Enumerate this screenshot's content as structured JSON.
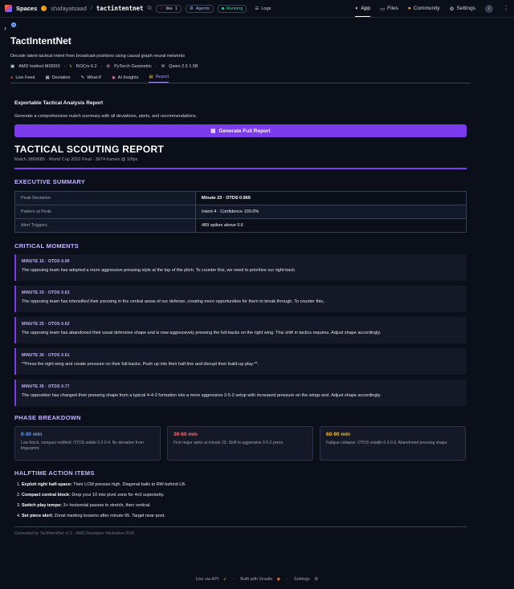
{
  "topbar": {
    "spaces_label": "Spaces",
    "owner": "shafayatsaad",
    "separator": "/",
    "repo": "tactintentnet",
    "like_label": "like",
    "like_count": "1",
    "agents_label": "Agents",
    "status_label": "Running",
    "logs_label": "Logs",
    "nav": {
      "app": "App",
      "files": "Files",
      "community": "Community",
      "settings": "Settings"
    },
    "info_badge": "i",
    "more": "⋮"
  },
  "app": {
    "title": "TactIntentNet",
    "description": "Decode latent tactical intent from broadcast positions using causal graph neural networks",
    "hardware": [
      "AMD Instinct MI300X",
      "ROCm 6.2",
      "PyTorch Geometric",
      "Qwen 2.5 1.5B"
    ],
    "hardware_sep": "·",
    "tabs": [
      {
        "label": "Live Feed",
        "icon": "●"
      },
      {
        "label": "Deviation",
        "icon": "▦"
      },
      {
        "label": "What-If",
        "icon": "✎"
      },
      {
        "label": "AI Insights",
        "icon": "◉"
      },
      {
        "label": "Report",
        "icon": "▤"
      }
    ],
    "active_tab": "Report"
  },
  "report_panel": {
    "heading": "Exportable Tactical Analysis Report",
    "subtext": "Generate a comprehensive match summary with all deviations, alerts, and recommendations.",
    "button_label": "Generate Full Report",
    "generated_by": "Generated by TactIntentNet v1.0 · AMD Developer Hackathon 2026"
  },
  "report": {
    "title": "TACTICAL SCOUTING REPORT",
    "meta": "Match 3869685 · World Cup 2022 Final · 3674 frames @ 10fps",
    "executive_summary": {
      "heading": "EXECUTIVE SUMMARY",
      "rows": [
        {
          "key": "Peak Deviation",
          "value": "Minute 23 · OTDS 0.969"
        },
        {
          "key": "Pattern at Peak",
          "value": "Intent 4 · Confidence 100.0%"
        },
        {
          "key": "Alert Triggers",
          "value": "489 spikes above 0.6"
        }
      ]
    },
    "critical_moments": {
      "heading": "CRITICAL MOMENTS",
      "items": [
        {
          "label": "MINUTE 15 · OTDS 0.90",
          "text": "The opposing team has adopted a more aggressive pressing style at the top of the pitch. To counter this, we need to prioritize our right-back."
        },
        {
          "label": "MINUTE 20 · OTDS 0.63",
          "text": "The opposing team has intensified their pressing in the central areas of our defense, creating more opportunities for them to break through. To counter this,."
        },
        {
          "label": "MINUTE 25 · OTDS 0.62",
          "text": "The opposing team has abandoned their usual defensive shape and is now aggressively pressing the full-backs on the right wing. This shift in tactics requires. Adjust shape accordingly."
        },
        {
          "label": "MINUTE 30 · OTDS 0.61",
          "text": "**Press the right wing and create pressure on their full-backs. Push up into their half-line and disrupt their build-up play.**."
        },
        {
          "label": "MINUTE 35 · OTDS 0.77",
          "text": "The opposition has changed their pressing shape from a typical 4-4-2 formation into a more aggressive 3-5-2 setup with increased pressure on the wings and. Adjust shape accordingly."
        }
      ]
    },
    "phase_breakdown": {
      "heading": "PHASE BREAKDOWN",
      "phases": [
        {
          "title": "0-30 min",
          "text": "Low block, compact midfield. OTDS stable 0.2-0.4. No deviation from fingerprint.",
          "color": "#60a5fa"
        },
        {
          "title": "30-60 min",
          "text": "First major spike at minute 23. Shift to aggressive 3-5-2 press.",
          "color": "#f87171"
        },
        {
          "title": "60-90 min",
          "text": "Fatigue collapse. OTDS volatile 0.3-0.9. Abandoned pressing shape.",
          "color": "#fbbf24"
        }
      ]
    },
    "halftime_actions": {
      "heading": "HALFTIME ACTION ITEMS",
      "items": [
        {
          "num": "1.",
          "bold": "Exploit right half-space:",
          "text": " Their LCM presses high. Diagonal balls to RW behind LB."
        },
        {
          "num": "2.",
          "bold": "Compact central block:",
          "text": " Drop your 10 into pivot zone for 4v3 superiority."
        },
        {
          "num": "3.",
          "bold": "Switch play tempo:",
          "text": " 3+ horizontal passes to stretch, then vertical."
        },
        {
          "num": "4.",
          "bold": "Set piece alert:",
          "text": " Zonal marking loosens after minute 65. Target near-post."
        }
      ]
    }
  },
  "footer": {
    "use_api": "Use via API",
    "built_with": "Built with Gradio",
    "settings": "Settings",
    "dot": "·"
  },
  "colors": {
    "accent": "#7c3aed",
    "background": "#0b0f19",
    "heading": "#c4b5fd"
  }
}
